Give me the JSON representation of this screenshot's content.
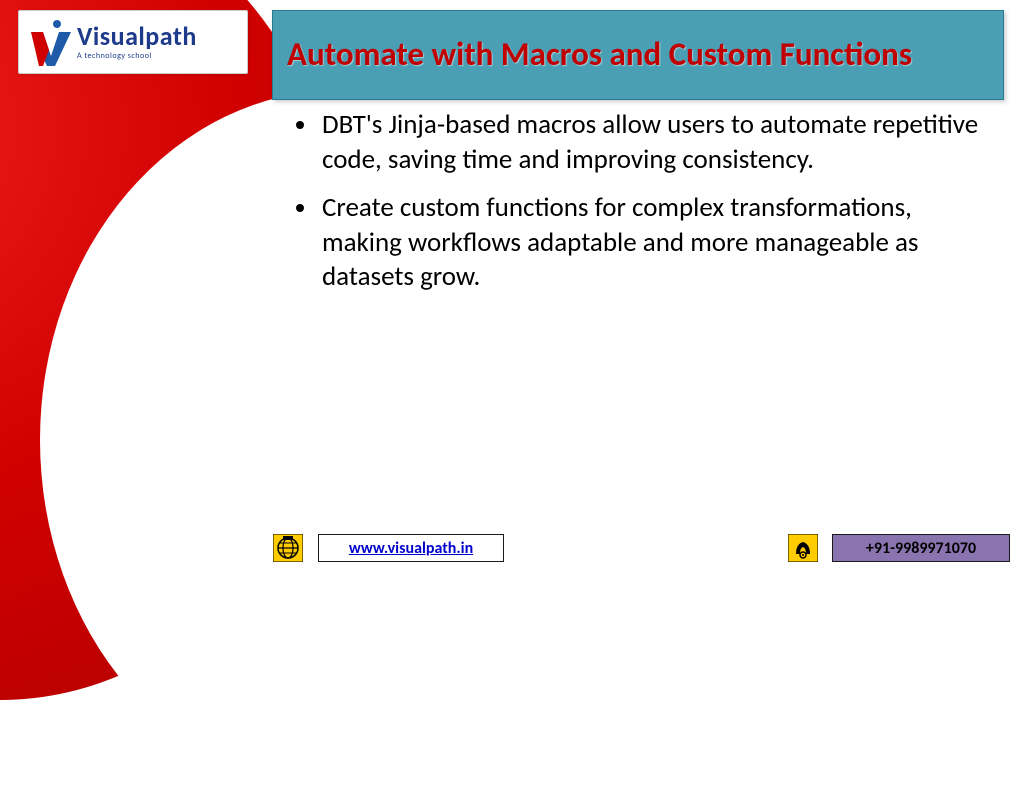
{
  "logo": {
    "brand": "Visualpath",
    "tagline": "A technology school"
  },
  "title": "Automate with Macros and Custom Functions",
  "bullets": [
    "DBT's Jinja-based macros allow users to automate repetitive code, saving time and improving consistency.",
    "Create custom functions for complex transformations, making workflows adaptable and more manageable as datasets grow."
  ],
  "footer": {
    "url": "www.visualpath.in",
    "phone": "+91-9989971070"
  }
}
